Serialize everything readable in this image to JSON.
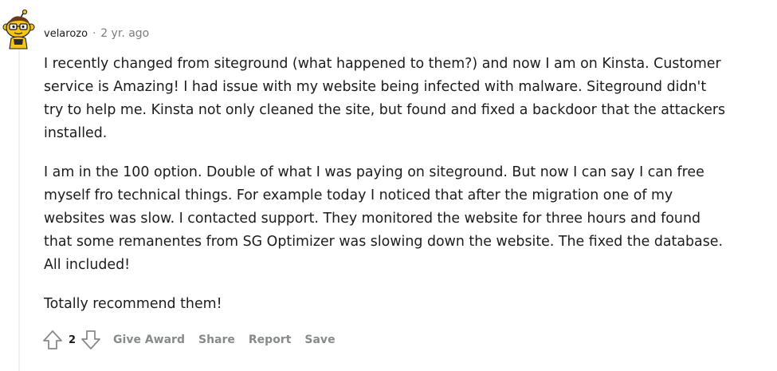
{
  "comment": {
    "username": "velarozo",
    "separator": "·",
    "timestamp": "2 yr. ago",
    "paragraphs": [
      [
        "I recently changed from siteground (what happened to them?) and now I am on Kinsta. Customer",
        "service is Amazing! I had issue with my website being infected with malware. Siteground didn't",
        "try to help me. Kinsta not only cleaned the site, but found and fixed a backdoor that the attackers",
        "installed."
      ],
      [
        "I am in the 100 option. Double of what I was paying on siteground. But now I can say I can free",
        "myself fro technical things. For example today I noticed that after the migration one of my",
        "websites was slow. I contacted support. They monitored the website for three hours and found",
        "that some remanentes from SG Optimizer was slowing down the website. The fixed the database.",
        "All included!"
      ],
      [
        "Totally recommend them!"
      ]
    ]
  },
  "actions": {
    "vote_count": "2",
    "give_award": "Give Award",
    "share": "Share",
    "report": "Report",
    "save": "Save"
  },
  "icons": {
    "avatar": "snoo-avatar-icon",
    "upvote": "upvote-arrow-icon",
    "downvote": "downvote-arrow-icon"
  },
  "colors": {
    "text": "#1c1c1c",
    "meta": "#7c7c7c",
    "action": "#878a8c",
    "thread_line": "#edeff1",
    "avatar_yellow": "#f5c518"
  }
}
